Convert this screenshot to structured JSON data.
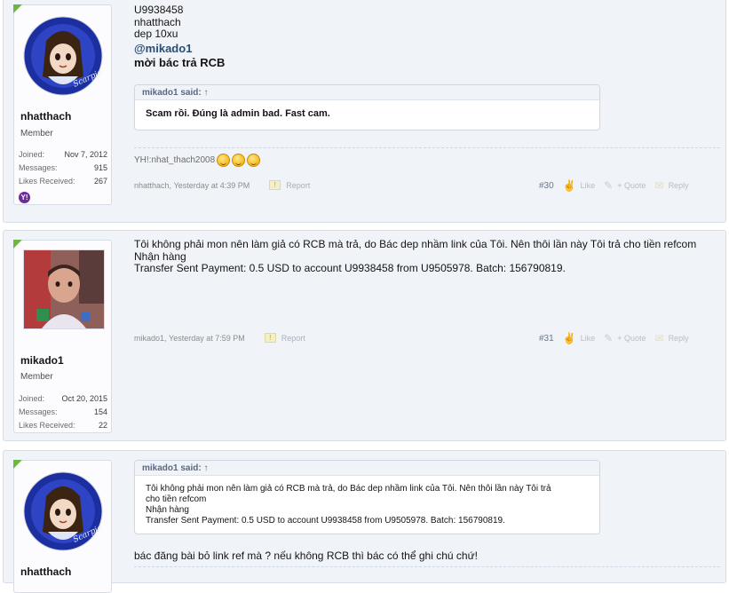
{
  "posts": [
    {
      "user": {
        "name": "nhatthach",
        "title": "Member",
        "stats": [
          {
            "label": "Joined:",
            "value": "Nov 7, 2012"
          },
          {
            "label": "Messages:",
            "value": "915"
          },
          {
            "label": "Likes Received:",
            "value": "267"
          }
        ],
        "badge": "Y!"
      },
      "lines": [
        "U9938458",
        "nhatthach",
        "dep 10xu"
      ],
      "mention": "@mikado1",
      "bold_line": "mời bác trả RCB",
      "quote": {
        "header": "mikado1 said: ↑",
        "body": "Scam rồi. Đúng là admin bad. Fast cam."
      },
      "signature": "YH!:nhat_thach2008",
      "meta": {
        "author": "nhatthach",
        "time": "Yesterday at 4:39 PM",
        "report": "Report"
      },
      "number": "#30"
    },
    {
      "user": {
        "name": "mikado1",
        "title": "Member",
        "stats": [
          {
            "label": "Joined:",
            "value": "Oct 20, 2015"
          },
          {
            "label": "Messages:",
            "value": "154"
          },
          {
            "label": "Likes Received:",
            "value": "22"
          }
        ]
      },
      "lines": [
        "Tôi không phải mon nên làm giả có RCB mà trả, do Bác dep nhầm link của Tôi. Nên thôi lần này Tôi trả cho tiền refcom",
        "Nhận hàng",
        "Transfer Sent Payment: 0.5 USD to account U9938458 from U9505978. Batch: 156790819."
      ],
      "meta": {
        "author": "mikado1",
        "time": "Yesterday at 7:59 PM",
        "report": "Report"
      },
      "number": "#31"
    },
    {
      "user": {
        "name": "nhatthach"
      },
      "quote": {
        "header": "mikado1 said: ↑",
        "body_lines": [
          "Tôi không phải mon nên làm giả có RCB mà trả, do Bác dep nhầm link của Tôi. Nên thôi lần này Tôi trả",
          "cho tiền refcom",
          "Nhận hàng",
          "Transfer Sent Payment: 0.5 USD to account U9938458 from U9505978. Batch: 156790819."
        ]
      },
      "text": "bác đăng bài bỏ link ref mà ? nếu không RCB thì bác có thể ghi chú chứ!"
    }
  ],
  "actions": {
    "like": "Like",
    "quote": "+ Quote",
    "reply": "Reply"
  },
  "colors": {
    "accent": "#6cb73d",
    "mention": "#2b4e72",
    "panel": "#f0f3f8"
  }
}
